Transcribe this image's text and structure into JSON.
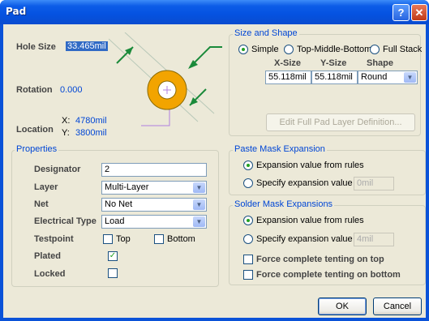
{
  "window": {
    "title": "Pad",
    "help_glyph": "?",
    "close_glyph": "✕"
  },
  "preview": {
    "hole_size_label": "Hole Size",
    "hole_size_value": "33.465mil",
    "rotation_label": "Rotation",
    "rotation_value": "0.000",
    "location_label": "Location",
    "x_label": "X:",
    "x_value": "4780mil",
    "y_label": "Y:",
    "y_value": "3800mil",
    "pad_color": "#f2a400",
    "hole_color": "#ffffff"
  },
  "size_shape": {
    "title": "Size and Shape",
    "options": [
      "Simple",
      "Top-Middle-Bottom",
      "Full Stack"
    ],
    "selected": "Simple",
    "col_xsize": "X-Size",
    "col_ysize": "Y-Size",
    "col_shape": "Shape",
    "xsize": "55.118mil",
    "ysize": "55.118mil",
    "shape": "Round",
    "edit_button": "Edit Full Pad Layer Definition..."
  },
  "properties": {
    "title": "Properties",
    "designator_label": "Designator",
    "designator_value": "2",
    "layer_label": "Layer",
    "layer_value": "Multi-Layer",
    "net_label": "Net",
    "net_value": "No Net",
    "electrical_label": "Electrical Type",
    "electrical_value": "Load",
    "testpoint_label": "Testpoint",
    "testpoint_top": "Top",
    "testpoint_bottom": "Bottom",
    "plated_label": "Plated",
    "plated_checked": true,
    "locked_label": "Locked",
    "locked_checked": false
  },
  "paste_mask": {
    "title": "Paste Mask Expansion",
    "opt_rules": "Expansion value from rules",
    "opt_specify": "Specify expansion value",
    "value": "0mil",
    "selected": "rules"
  },
  "solder_mask": {
    "title": "Solder Mask Expansions",
    "opt_rules": "Expansion value from rules",
    "opt_specify": "Specify expansion value",
    "value": "4mil",
    "selected": "rules",
    "tent_top": "Force complete tenting on top",
    "tent_bottom": "Force complete tenting on bottom"
  },
  "buttons": {
    "ok": "OK",
    "cancel": "Cancel"
  },
  "glyphs": {
    "check": "✓",
    "dropdown": "▼"
  }
}
